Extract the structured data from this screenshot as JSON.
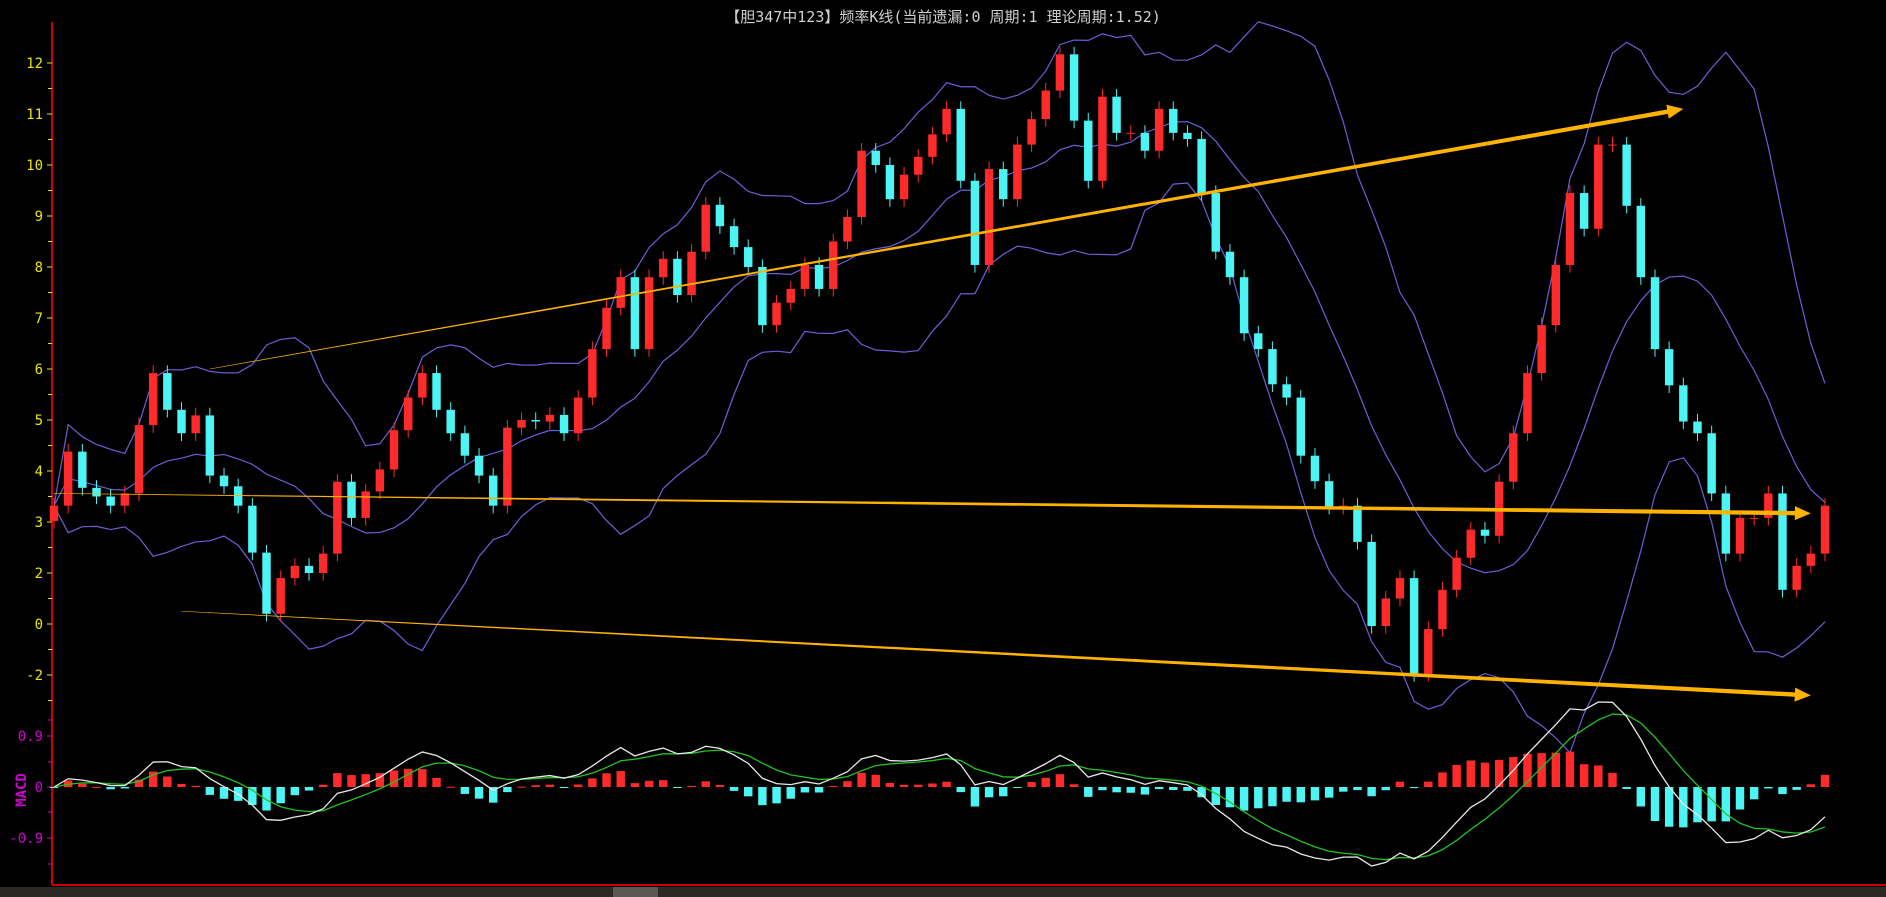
{
  "title": "【胆347中123】频率K线(当前遗漏:0 周期:1 理论周期:1.52)",
  "colors": {
    "up": "#ff2a2a",
    "down": "#4cf4f4",
    "band": "#6b5fd8",
    "axis": "#cc0000",
    "price_tick": "#e8e800",
    "macd_tick": "#d000d0",
    "dif": "#e8e8e8",
    "dea": "#22c322",
    "trend": "#ffb300"
  },
  "chart_data": [
    {
      "type": "candlestick",
      "title": "频率K线",
      "y_ticks": [
        {
          "value": 12,
          "label": "12"
        },
        {
          "value": 11,
          "label": "11"
        },
        {
          "value": 10,
          "label": "10"
        },
        {
          "value": 9,
          "label": "9"
        },
        {
          "value": 8,
          "label": "8"
        },
        {
          "value": 7,
          "label": "7"
        },
        {
          "value": 6,
          "label": "6"
        },
        {
          "value": 5,
          "label": "5"
        },
        {
          "value": 4,
          "label": "4"
        },
        {
          "value": 3,
          "label": "3"
        },
        {
          "value": 2,
          "label": "2"
        },
        {
          "value": 1,
          "label": "0"
        },
        {
          "value": 0,
          "label": "-2"
        }
      ],
      "ylim": [
        -0.3,
        12.6
      ],
      "indicator": "Bollinger bands (upper/mid/lower)",
      "closes": [
        3.32,
        4.38,
        3.67,
        3.5,
        3.32,
        3.56,
        4.9,
        5.92,
        5.2,
        4.74,
        5.09,
        3.91,
        3.7,
        3.32,
        2.4,
        1.2,
        1.9,
        2.14,
        2.0,
        2.38,
        3.79,
        3.08,
        3.6,
        4.03,
        4.8,
        5.44,
        5.92,
        5.2,
        4.74,
        4.3,
        3.91,
        3.32,
        4.85,
        5.0,
        4.97,
        5.1,
        4.74,
        5.44,
        6.39,
        7.2,
        7.8,
        6.39,
        7.8,
        8.16,
        7.45,
        8.3,
        9.22,
        8.8,
        8.39,
        8.0,
        6.86,
        7.3,
        7.57,
        8.04,
        7.57,
        8.5,
        8.98,
        10.28,
        10.0,
        9.33,
        9.81,
        10.16,
        10.6,
        11.1,
        9.69,
        8.04,
        9.92,
        9.33,
        10.4,
        10.9,
        11.46,
        12.17,
        10.87,
        9.69,
        11.34,
        10.63,
        10.63,
        10.28,
        11.1,
        10.63,
        10.51,
        9.45,
        8.3,
        7.8,
        6.7,
        6.39,
        5.7,
        5.44,
        4.3,
        3.8,
        3.3,
        3.32,
        2.61,
        0.96,
        1.5,
        1.9,
        0.02,
        0.9,
        1.67,
        2.3,
        2.85,
        2.73,
        3.79,
        4.74,
        5.92,
        6.86,
        8.04,
        9.45,
        8.75,
        10.4,
        10.4,
        9.2,
        7.8,
        6.39,
        5.68,
        4.97,
        4.74,
        3.56,
        2.38,
        3.08,
        3.08,
        3.56,
        1.67,
        2.14,
        2.38,
        3.32
      ],
      "trend_lines": [
        {
          "from": {
            "index": 11,
            "value": 6.0
          },
          "to": {
            "index": 115,
            "value": 11.1
          }
        },
        {
          "from": {
            "index": 0,
            "value": 3.56
          },
          "to": {
            "index": 124,
            "value": 3.17
          }
        },
        {
          "from": {
            "index": 9,
            "value": 1.25
          },
          "to": {
            "index": 124,
            "value": -0.4
          }
        }
      ]
    },
    {
      "type": "macd",
      "label": "MACD",
      "y_ticks": [
        {
          "value": 0.9,
          "label": "0.9"
        },
        {
          "value": 0,
          "label": "0"
        },
        {
          "value": -0.9,
          "label": "-0.9"
        }
      ],
      "series": [
        "DIF",
        "DEA",
        "MACD histogram"
      ]
    }
  ]
}
